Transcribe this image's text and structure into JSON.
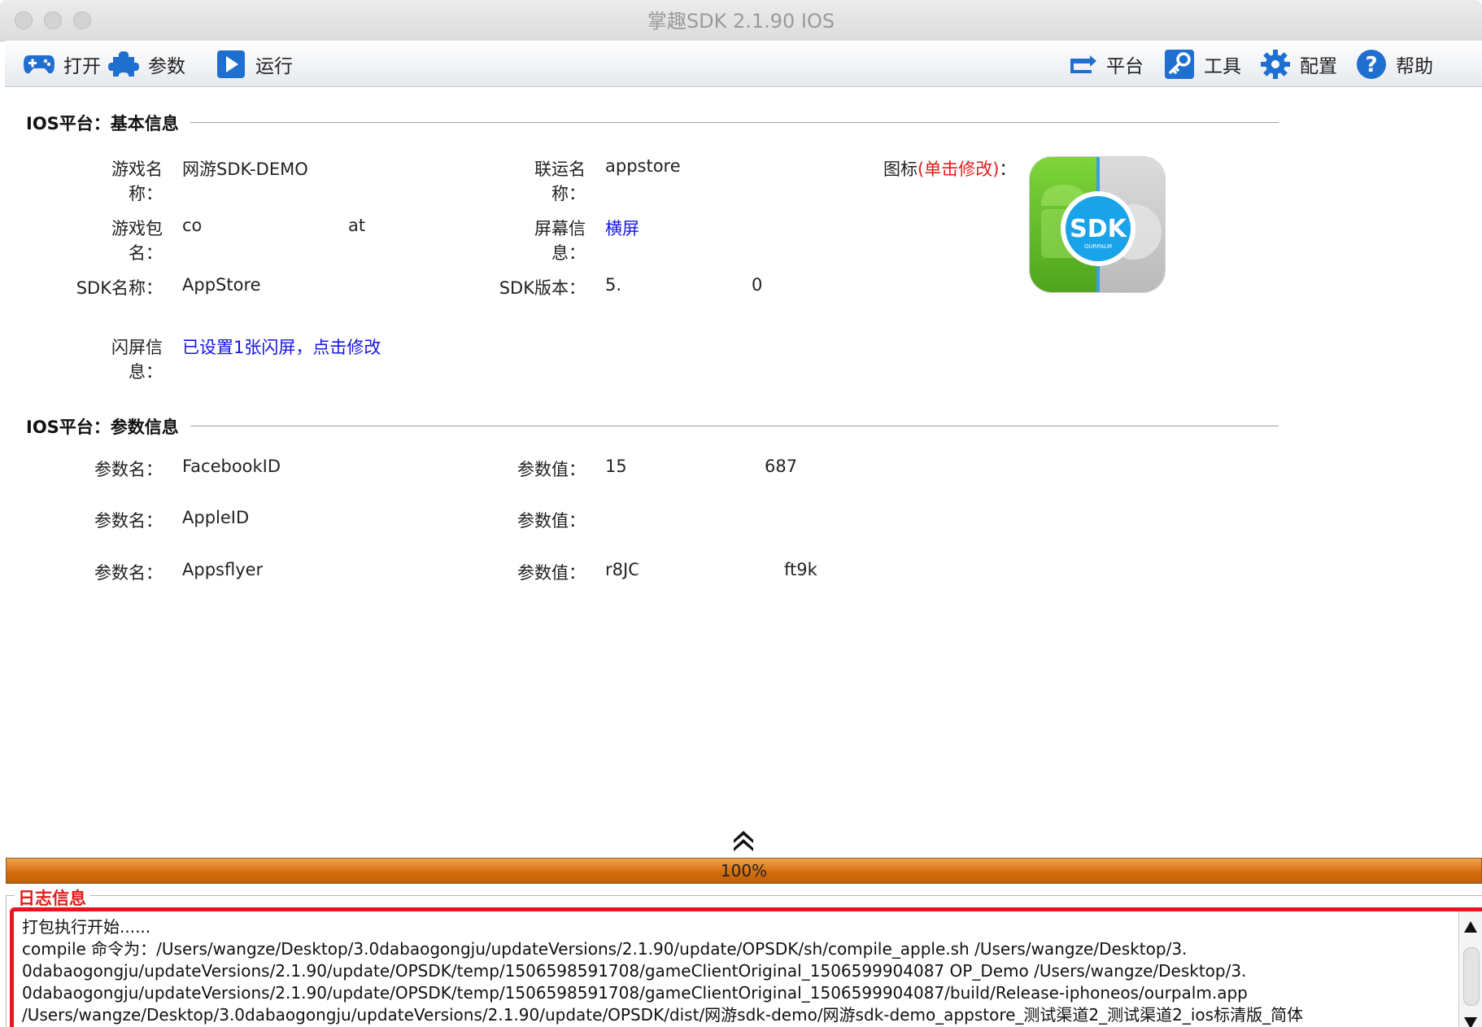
{
  "window": {
    "title": "掌趣SDK 2.1.90  IOS"
  },
  "toolbar": {
    "left": [
      {
        "label": "打开",
        "icon": "gamepad-icon"
      },
      {
        "label": "参数",
        "icon": "puzzle-icon"
      },
      {
        "label": "运行",
        "icon": "play-icon"
      }
    ],
    "right": [
      {
        "label": "平台",
        "icon": "refresh-arrow-icon"
      },
      {
        "label": "工具",
        "icon": "key-icon"
      },
      {
        "label": "配置",
        "icon": "gear-icon"
      },
      {
        "label": "帮助",
        "icon": "help-icon"
      }
    ]
  },
  "basic_info": {
    "heading": "IOS平台：基本信息",
    "game_name_label": "游戏名称：",
    "game_name": "网游SDK-DEMO",
    "channel_name_label": "联运名称：",
    "channel_name": "appstore",
    "icon_label_prefix": "图标",
    "icon_label_action": "(单击修改)",
    "icon_label_suffix": "：",
    "package_label": "游戏包名：",
    "package_value": "co",
    "package_value_end": "at",
    "screen_label": "屏幕信息：",
    "screen_value": "横屏",
    "sdk_name_label": "SDK名称：",
    "sdk_name": "AppStore",
    "sdk_version_label": "SDK版本：",
    "sdk_version": "5.",
    "sdk_version_end": "0",
    "splash_label": "闪屏信息：",
    "splash_value": "已设置1张闪屏，点击修改",
    "icon_badge_text": "SDK",
    "icon_badge_sub": "OURPALM"
  },
  "params_info": {
    "heading": "IOS平台：参数信息",
    "rows": [
      {
        "name_label": "参数名：",
        "name": "FacebookID",
        "value_label": "参数值：",
        "value": "15",
        "value_end": "687"
      },
      {
        "name_label": "参数名：",
        "name": "AppleID",
        "value_label": "参数值：",
        "value": "",
        "value_end": ""
      },
      {
        "name_label": "参数名：",
        "name": "Appsflyer",
        "value_label": "参数值：",
        "value": "r8JC",
        "value_end": "ft9k"
      }
    ]
  },
  "progress": {
    "value": 1.0,
    "label": "100%",
    "fill_color": "#d46f0f"
  },
  "log": {
    "title": "日志信息",
    "lines": [
      "打包执行开始......",
      "compile 命令为：/Users/wangze/Desktop/3.0dabaogongju/updateVersions/2.1.90/update/OPSDK/sh/compile_apple.sh /Users/wangze/Desktop/3.",
      "0dabaogongju/updateVersions/2.1.90/update/OPSDK/temp/1506598591708/gameClientOriginal_1506599904087 OP_Demo /Users/wangze/Desktop/3.",
      "0dabaogongju/updateVersions/2.1.90/update/OPSDK/temp/1506598591708/gameClientOriginal_1506599904087/build/Release-iphoneos/ourpalm.app",
      "/Users/wangze/Desktop/3.0dabaogongju/updateVersions/2.1.90/update/OPSDK/dist/网游sdk-demo/网游sdk-demo_appstore_测试渠道2_测试渠道2_ios标清版_简体"
    ]
  }
}
